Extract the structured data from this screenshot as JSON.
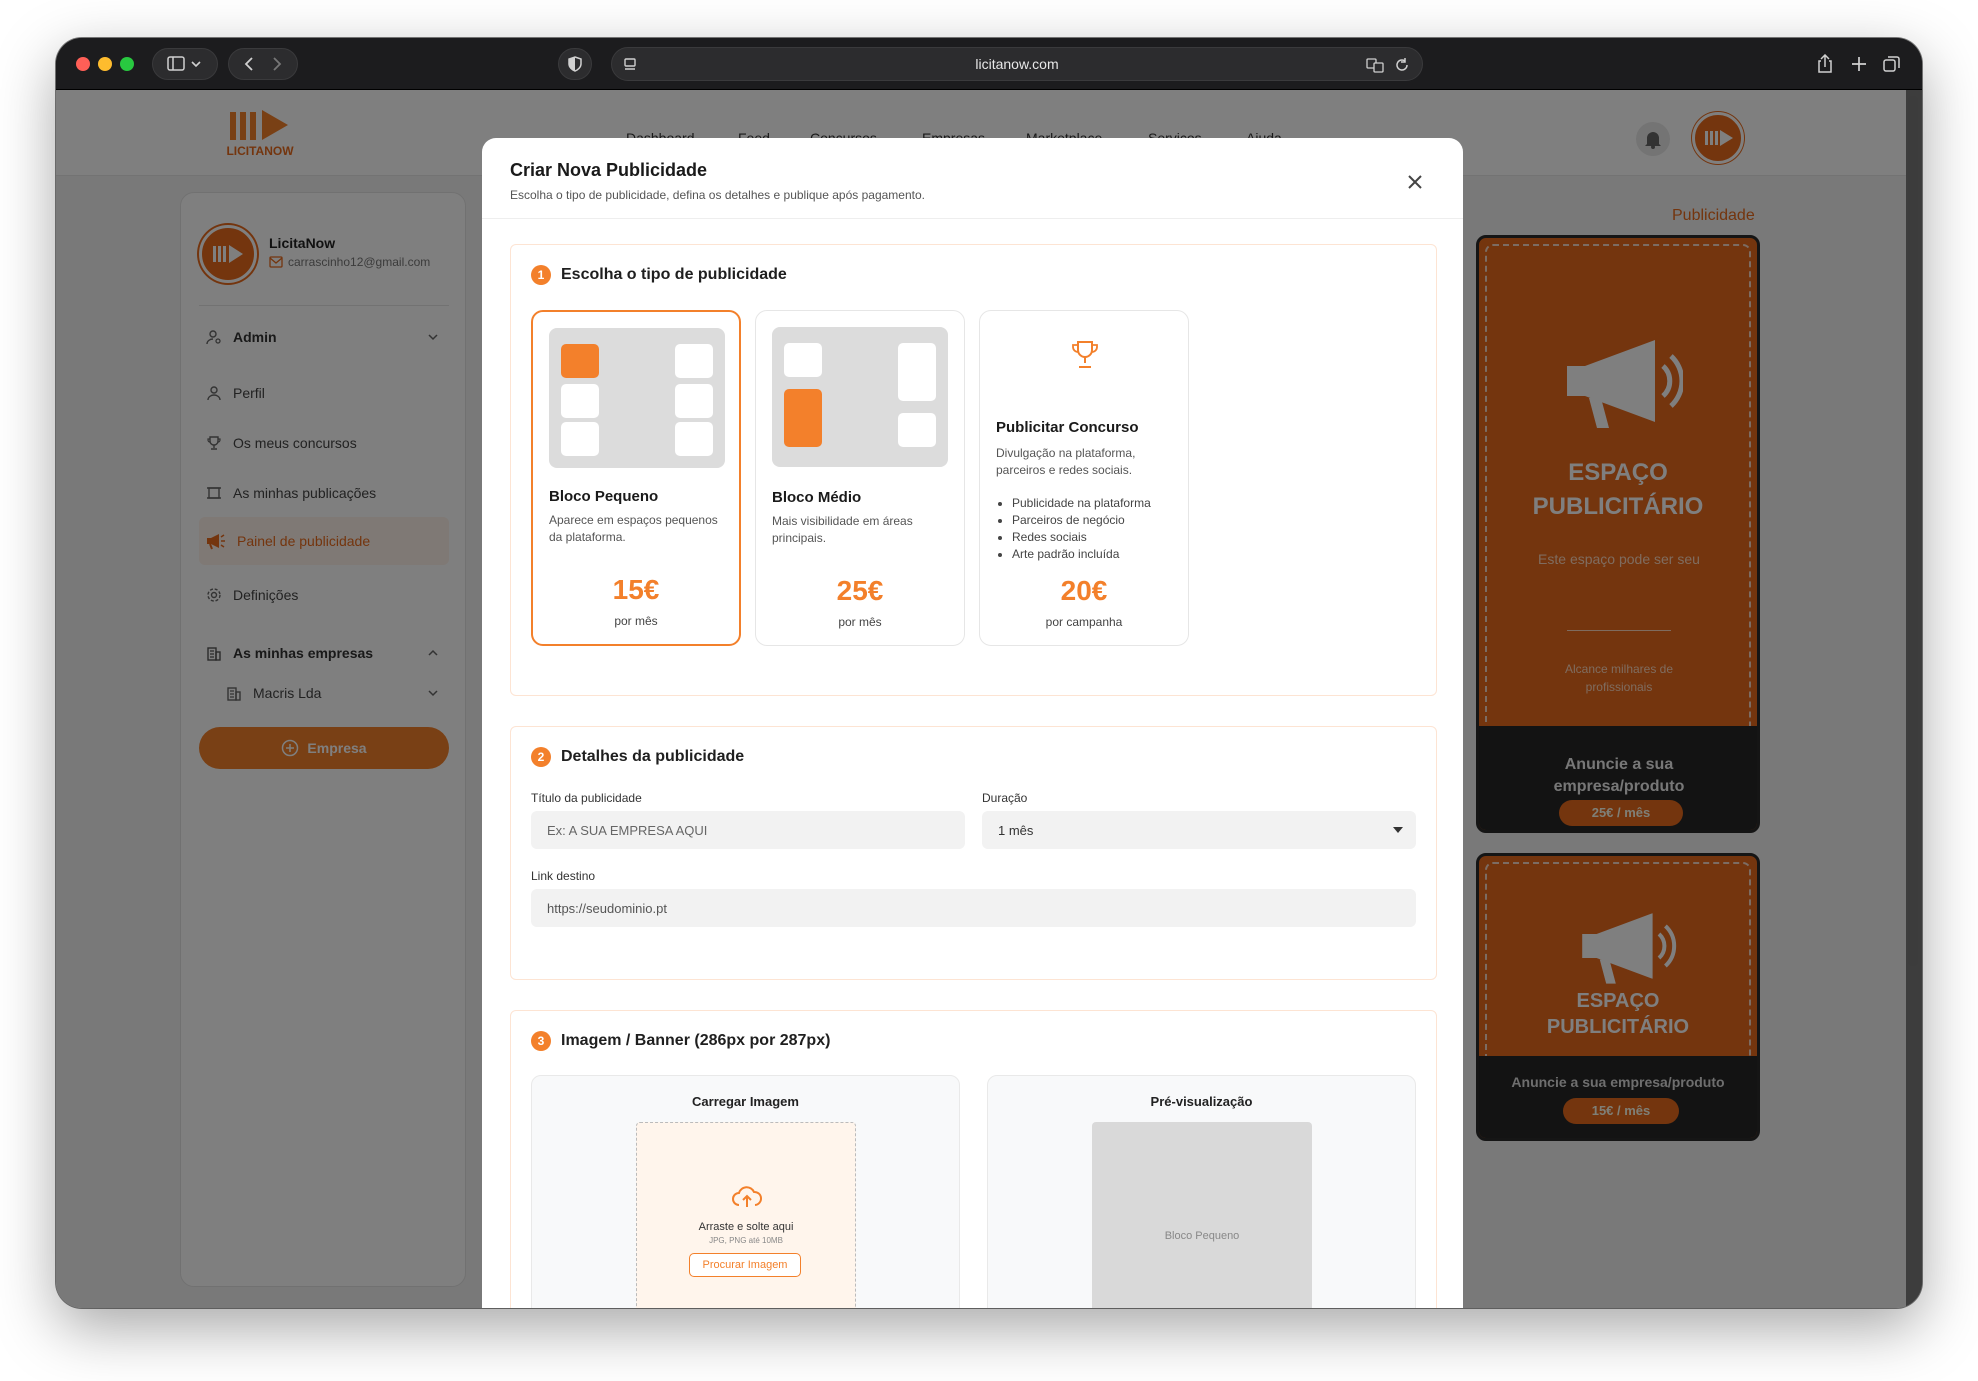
{
  "browser": {
    "url": "licitanow.com",
    "colors": {
      "close": "#ff5f57",
      "minimize": "#febc2e",
      "zoom": "#28c840"
    }
  },
  "site": {
    "logo_text": "LICITANOW",
    "nav": [
      "Dashboard",
      "Feed",
      "Concursos",
      "Empresas",
      "Marketplace",
      "Serviços",
      "Ajuda"
    ],
    "accent": "#f3802b"
  },
  "sidebar": {
    "user_name": "LicitaNow",
    "user_email": "carrascinho12@gmail.com",
    "admin_label": "Admin",
    "items": [
      {
        "label": "Perfil",
        "icon": "user-icon"
      },
      {
        "label": "Os meus concursos",
        "icon": "trophy-icon"
      },
      {
        "label": "As minhas publicações",
        "icon": "publications-icon"
      },
      {
        "label": "Painel de publicidade",
        "icon": "megaphone-icon"
      },
      {
        "label": "Definições",
        "icon": "gear-icon"
      }
    ],
    "companies_label": "As minhas empresas",
    "company": "Macris Lda",
    "add_company": "Empresa"
  },
  "ads": {
    "section_title": "Publicidade",
    "large": {
      "title_line1": "ESPAÇO",
      "title_line2": "PUBLICITÁRIO",
      "sub": "Este espaço pode ser seu",
      "sub2": "Alcance milhares de profissionais",
      "foot": "Anuncie a sua empresa/produto",
      "price": "25€ / mês"
    },
    "small": {
      "title_line1": "ESPAÇO",
      "title_line2": "PUBLICITÁRIO",
      "foot": "Anuncie a sua empresa/produto",
      "price": "15€ / mês"
    }
  },
  "modal": {
    "title": "Criar Nova Publicidade",
    "subtitle": "Escolha o tipo de publicidade, defina os detalhes e publique após pagamento.",
    "step1": {
      "num": "1",
      "title": "Escolha o tipo de publicidade",
      "cards": [
        {
          "title": "Bloco Pequeno",
          "desc": "Aparece em espaços pequenos da plataforma.",
          "price": "15€",
          "per": "por mês"
        },
        {
          "title": "Bloco Médio",
          "desc": "Mais visibilidade em áreas principais.",
          "price": "25€",
          "per": "por mês"
        },
        {
          "title": "Publicitar Concurso",
          "desc": "Divulgação na plataforma, parceiros e redes sociais.",
          "bullets": [
            "Publicidade na plataforma",
            "Parceiros de negócio",
            "Redes sociais",
            "Arte padrão incluída"
          ],
          "price": "20€",
          "per": "por campanha"
        }
      ]
    },
    "step2": {
      "num": "2",
      "title": "Detalhes da publicidade",
      "title_label": "Título da publicidade",
      "title_placeholder": "Ex: A SUA EMPRESA AQUI",
      "duration_label": "Duração",
      "duration_value": "1 mês",
      "link_label": "Link destino",
      "link_placeholder": "https://seudominio.pt"
    },
    "step3": {
      "num": "3",
      "title": "Imagem / Banner (286px por 287px)",
      "upload_title": "Carregar Imagem",
      "drop_text": "Arraste e solte aqui",
      "formats": "JPG, PNG até 10MB",
      "browse": "Procurar Imagem",
      "preview_title": "Pré-visualização",
      "preview_placeholder": "Bloco Pequeno"
    }
  }
}
